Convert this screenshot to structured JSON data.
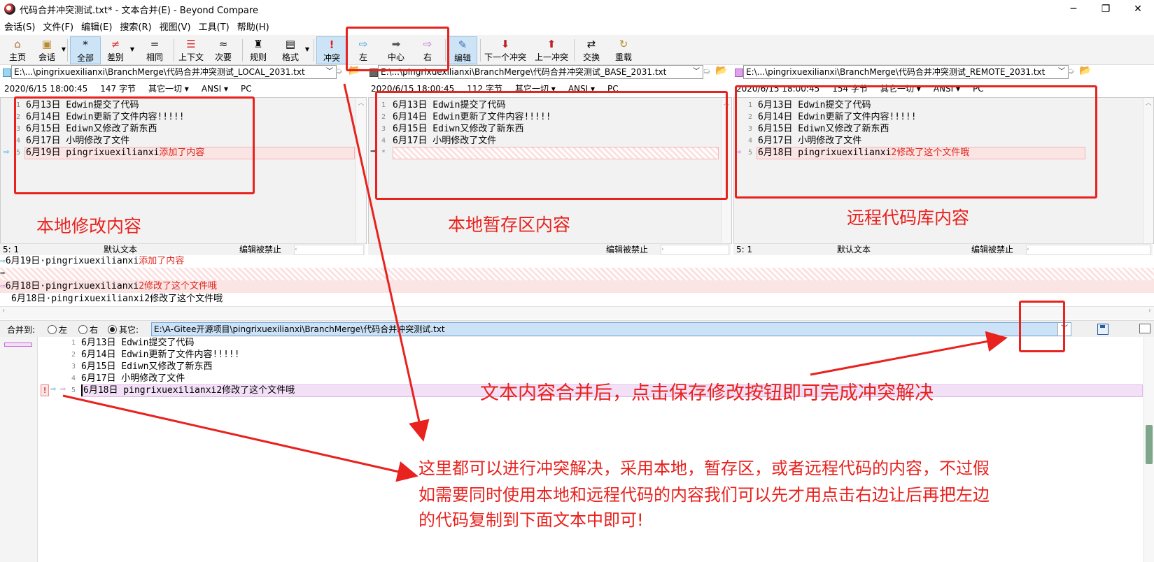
{
  "window": {
    "title": "代码合并冲突测试.txt* - 文本合并(E) - Beyond Compare",
    "controls": [
      "─",
      "❐",
      "✕"
    ]
  },
  "menu": [
    "会话(S)",
    "文件(F)",
    "编辑(E)",
    "搜索(R)",
    "视图(V)",
    "工具(T)",
    "帮助(H)"
  ],
  "toolbar": {
    "home": "主页",
    "session": "会话",
    "all": "全部",
    "diff": "差别",
    "same": "相同",
    "context": "上下文",
    "minor": "次要",
    "rules": "规则",
    "format": "格式",
    "conflict": "冲突",
    "left": "左",
    "center": "中心",
    "right": "右",
    "edit": "编辑",
    "next_conflict": "下一个冲突",
    "prev_conflict": "上一冲突",
    "swap": "交换",
    "reload": "重载"
  },
  "paths": {
    "local": "E:\\...\\pingrixuexilianxi\\BranchMerge\\代码合并冲突测试_LOCAL_2031.txt",
    "base": "E:\\...\\pingrixuexilianxi\\BranchMerge\\代码合并冲突测试_BASE_2031.txt",
    "remote": "E:\\...\\pingrixuexilianxi\\BranchMerge\\代码合并冲突测试_REMOTE_2031.txt"
  },
  "info": {
    "local": {
      "date": "2020/6/15 18:00:45",
      "size": "147 字节",
      "other": "其它一切 ▾",
      "enc": "ANSI ▾",
      "eol": "PC"
    },
    "base": {
      "date": "2020/6/15 18:00:45",
      "size": "112 字节",
      "other": "其它一切 ▾",
      "enc": "ANSI ▾",
      "eol": "PC"
    },
    "remote": {
      "date": "2020/6/15 18:00:45",
      "size": "154 字节",
      "other": "其它一切 ▾",
      "enc": "ANSI ▾",
      "eol": "PC"
    }
  },
  "lines_common": [
    "6月13日  Edwin提交了代码",
    "6月14日  Edwin更新了文件内容!!!!!",
    "6月15日  Ediwn又修改了新东西",
    "6月17日  小明修改了文件"
  ],
  "local_last": {
    "pre": "6月19日  pingrixuexilianxi",
    "red": "添加了内容"
  },
  "remote_last": {
    "pre": "6月18日  pingrixuexilianxi",
    "red": "2修改了这个文件哦"
  },
  "line_numbers": [
    "1",
    "2",
    "3",
    "4",
    "5"
  ],
  "base_last_num": "*",
  "status": {
    "pos": "5: 1",
    "mode": "默认文本",
    "edit": "编辑被禁止"
  },
  "overview": {
    "line1_pre": "6月19日·pingrixuexilianxi",
    "line1_red": "添加了内容",
    "line3_pre": "6月18日·pingrixuexilianxi",
    "line3_red": "2修改了这个文件哦",
    "line4": "6月18日·pingrixuexilianxi2修改了这个文件哦"
  },
  "merge": {
    "label": "合并到:",
    "left": "左",
    "right": "右",
    "other": "其它:",
    "path": "E:\\A-Gitee开源项目\\pingrixuexilianxi\\BranchMerge\\代码合并冲突测试.txt"
  },
  "output_last": "6月18日  pingrixuexilianxi2修改了这个文件哦",
  "annotations": {
    "local": "本地修改内容",
    "base": "本地暂存区内容",
    "remote": "远程代码库内容",
    "save": "文本内容合并后，点击保存修改按钮即可完成冲突解决",
    "resolve1": "这里都可以进行冲突解决，采用本地，暂存区，或者远程代码的内容，不过假",
    "resolve2": "如需要同时使用本地和远程代码的内容我们可以先才用点击右边让后再把左边",
    "resolve3": "的代码复制到下面文本中即可!"
  },
  "colors": {
    "annotation": "#e8221e",
    "conflict_bg": "#fbe4e4",
    "output_highlight": "#f2e0f7"
  }
}
